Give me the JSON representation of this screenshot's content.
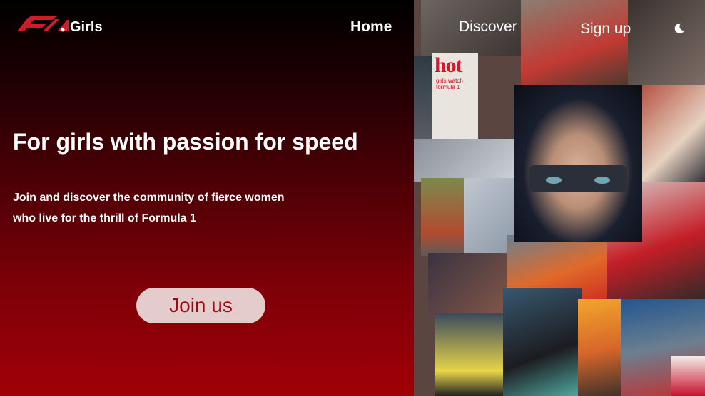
{
  "nav": {
    "brand": "Girls",
    "logo_icon": "f1-logo-icon",
    "items": [
      {
        "label": "Home",
        "active": true
      },
      {
        "label": "Discover",
        "active": false
      },
      {
        "label": "Sign up",
        "active": false
      }
    ],
    "theme_toggle_icon": "moon-icon"
  },
  "hero": {
    "title": "For girls with passion for speed",
    "subtitle_line1": "Join and discover the community of fierce women",
    "subtitle_line2": "who live for the thrill of Formula 1",
    "cta_label": "Join us"
  },
  "collage": {
    "magazine_title": "hot",
    "magazine_subtitle": "girls watch formula 1"
  },
  "colors": {
    "accent": "#c8102e",
    "cta_bg": "#e5cccc",
    "cta_text": "#9b0a12",
    "gradient_top": "#000000",
    "gradient_bottom": "#a00006"
  }
}
